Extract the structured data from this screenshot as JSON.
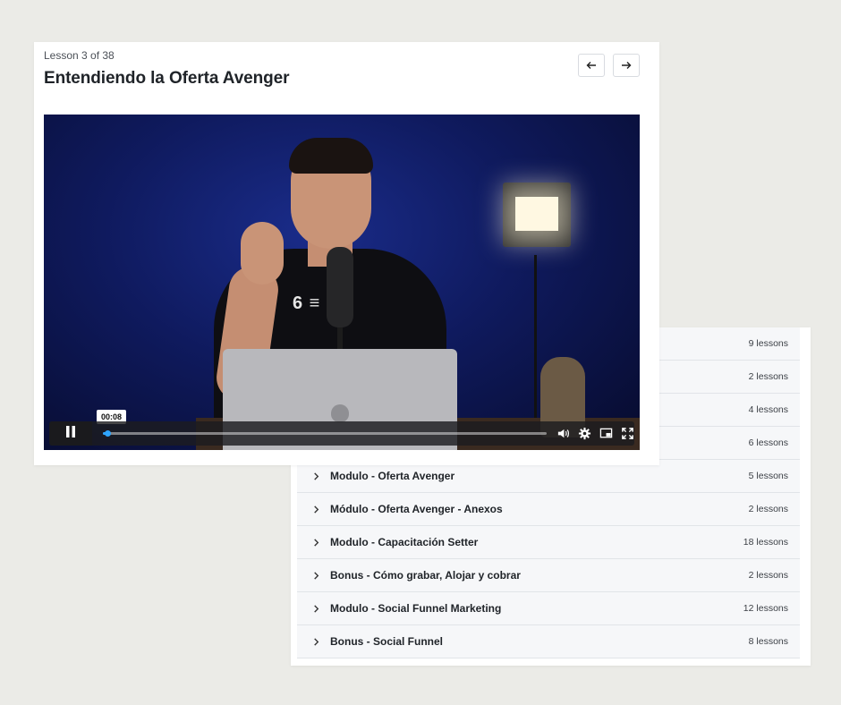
{
  "lesson": {
    "progress_label": "Lesson 3 of 38",
    "title": "Entendiendo la Oferta Avenger",
    "prev_icon": "arrow-left-icon",
    "next_icon": "arrow-right-icon"
  },
  "video": {
    "current_time": "00:08",
    "progress_fraction": 0.01,
    "shirt_text": "6 ≡ 3D",
    "accent_color": "#2ea4ff",
    "controls": [
      "pause-icon",
      "volume-icon",
      "settings-icon",
      "picture-in-picture-icon",
      "fullscreen-icon"
    ]
  },
  "modules": [
    {
      "title": "",
      "count": "9 lessons"
    },
    {
      "title": "",
      "count": "2 lessons"
    },
    {
      "title": "",
      "count": "4 lessons"
    },
    {
      "title": "",
      "count": "6 lessons"
    },
    {
      "title": "Modulo - Oferta Avenger",
      "count": "5 lessons"
    },
    {
      "title": "Módulo - Oferta Avenger - Anexos",
      "count": "2 lessons"
    },
    {
      "title": "Modulo - Capacitación Setter",
      "count": "18 lessons"
    },
    {
      "title": "Bonus - Cómo grabar, Alojar y cobrar",
      "count": "2 lessons"
    },
    {
      "title": "Modulo - Social Funnel Marketing",
      "count": "12 lessons"
    },
    {
      "title": "Bonus - Social Funnel",
      "count": "8 lessons"
    }
  ]
}
